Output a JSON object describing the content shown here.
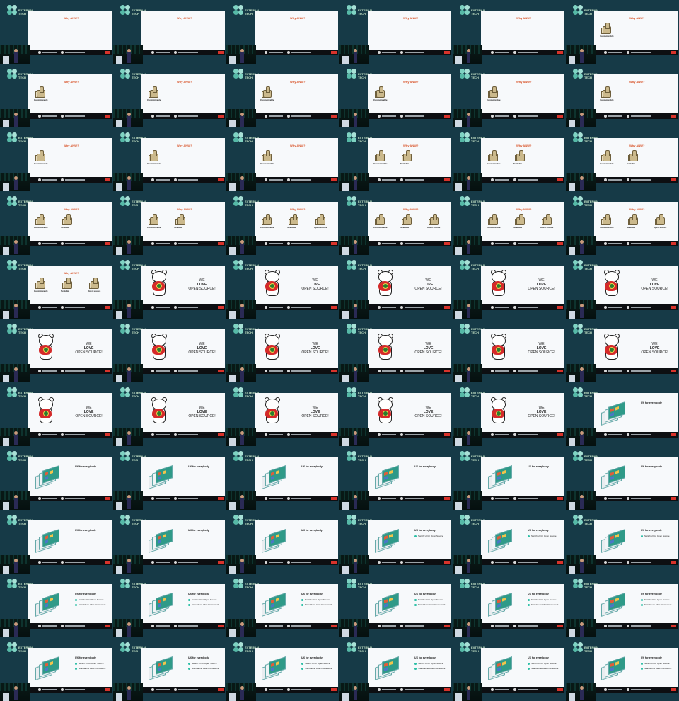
{
  "logo": {
    "line1": "EXTERNAL",
    "line2": "TECH"
  },
  "slides": {
    "why": {
      "title": "Why ANW?"
    },
    "thumbs": [
      "Customizable",
      "Scalable",
      "Open source"
    ],
    "love": {
      "l1": "WE",
      "l2": "LOVE",
      "l3": "OPEN SOURCE!"
    },
    "ui": {
      "title": "UX for everybody",
      "bullets": [
        "Switch UI for Open Source",
        "Standalone Atlas Framework"
      ]
    }
  },
  "frames": [
    {
      "type": "why-empty"
    },
    {
      "type": "why-empty"
    },
    {
      "type": "why-empty"
    },
    {
      "type": "why-empty"
    },
    {
      "type": "why-empty"
    },
    {
      "type": "thumbs",
      "n": 1
    },
    {
      "type": "thumbs",
      "n": 1
    },
    {
      "type": "thumbs",
      "n": 1
    },
    {
      "type": "thumbs",
      "n": 1
    },
    {
      "type": "thumbs",
      "n": 1
    },
    {
      "type": "thumbs",
      "n": 1
    },
    {
      "type": "thumbs",
      "n": 1
    },
    {
      "type": "thumbs",
      "n": 1
    },
    {
      "type": "thumbs",
      "n": 1
    },
    {
      "type": "thumbs",
      "n": 1
    },
    {
      "type": "thumbs",
      "n": 2
    },
    {
      "type": "thumbs",
      "n": 2
    },
    {
      "type": "thumbs",
      "n": 2
    },
    {
      "type": "thumbs",
      "n": 2
    },
    {
      "type": "thumbs",
      "n": 2
    },
    {
      "type": "thumbs",
      "n": 3
    },
    {
      "type": "thumbs",
      "n": 3
    },
    {
      "type": "thumbs",
      "n": 3
    },
    {
      "type": "thumbs",
      "n": 3
    },
    {
      "type": "thumbs",
      "n": 3
    },
    {
      "type": "love"
    },
    {
      "type": "love"
    },
    {
      "type": "love"
    },
    {
      "type": "love"
    },
    {
      "type": "love"
    },
    {
      "type": "love"
    },
    {
      "type": "love"
    },
    {
      "type": "love"
    },
    {
      "type": "love"
    },
    {
      "type": "love"
    },
    {
      "type": "love"
    },
    {
      "type": "love"
    },
    {
      "type": "love"
    },
    {
      "type": "love"
    },
    {
      "type": "love"
    },
    {
      "type": "love"
    },
    {
      "type": "ui",
      "b": 0
    },
    {
      "type": "ui",
      "b": 0
    },
    {
      "type": "ui",
      "b": 0
    },
    {
      "type": "ui",
      "b": 0
    },
    {
      "type": "ui",
      "b": 0
    },
    {
      "type": "ui",
      "b": 0
    },
    {
      "type": "ui",
      "b": 0
    },
    {
      "type": "ui",
      "b": 0
    },
    {
      "type": "ui",
      "b": 0
    },
    {
      "type": "ui",
      "b": 0
    },
    {
      "type": "ui",
      "b": 1
    },
    {
      "type": "ui",
      "b": 1
    },
    {
      "type": "ui",
      "b": 1
    },
    {
      "type": "ui",
      "b": 2
    },
    {
      "type": "ui",
      "b": 2
    },
    {
      "type": "ui",
      "b": 2
    },
    {
      "type": "ui",
      "b": 2
    },
    {
      "type": "ui",
      "b": 2
    },
    {
      "type": "ui",
      "b": 2
    },
    {
      "type": "ui",
      "b": 2
    },
    {
      "type": "ui",
      "b": 2
    },
    {
      "type": "ui",
      "b": 2
    },
    {
      "type": "ui",
      "b": 2
    },
    {
      "type": "ui",
      "b": 2
    },
    {
      "type": "ui",
      "b": 2
    }
  ]
}
